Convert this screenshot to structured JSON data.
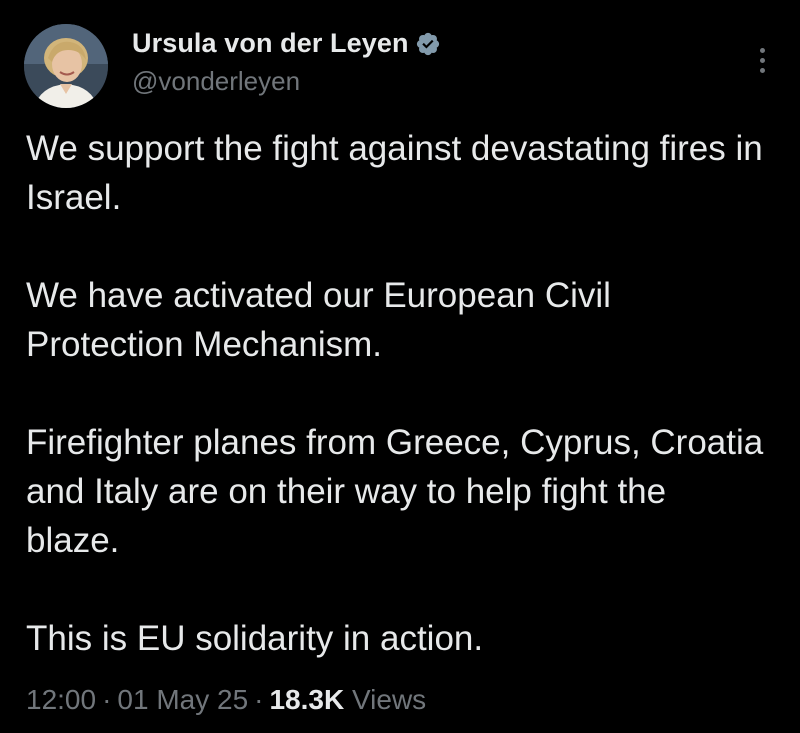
{
  "author": {
    "display_name": "Ursula von der Leyen",
    "handle": "@vonderleyen",
    "verified": true,
    "avatar": "profile-photo"
  },
  "tweet": {
    "paragraphs": [
      "We support the fight against devastating fires in Israel.",
      "We have activated our European Civil Protection Mechanism.",
      "Firefighter planes from Greece, Cyprus, Croatia and Italy are on their way to help fight the blaze.",
      "This is EU solidarity in action."
    ]
  },
  "meta": {
    "time": "12:00",
    "separator": "·",
    "date": "01 May 25",
    "views_count": "18.3K",
    "views_label": "Views"
  },
  "icons": {
    "verified": "verified-badge-icon",
    "more": "more-options-icon"
  },
  "colors": {
    "background": "#000000",
    "text_primary": "#e7e9ea",
    "text_secondary": "#71767b",
    "verified_badge": "#829aab"
  }
}
